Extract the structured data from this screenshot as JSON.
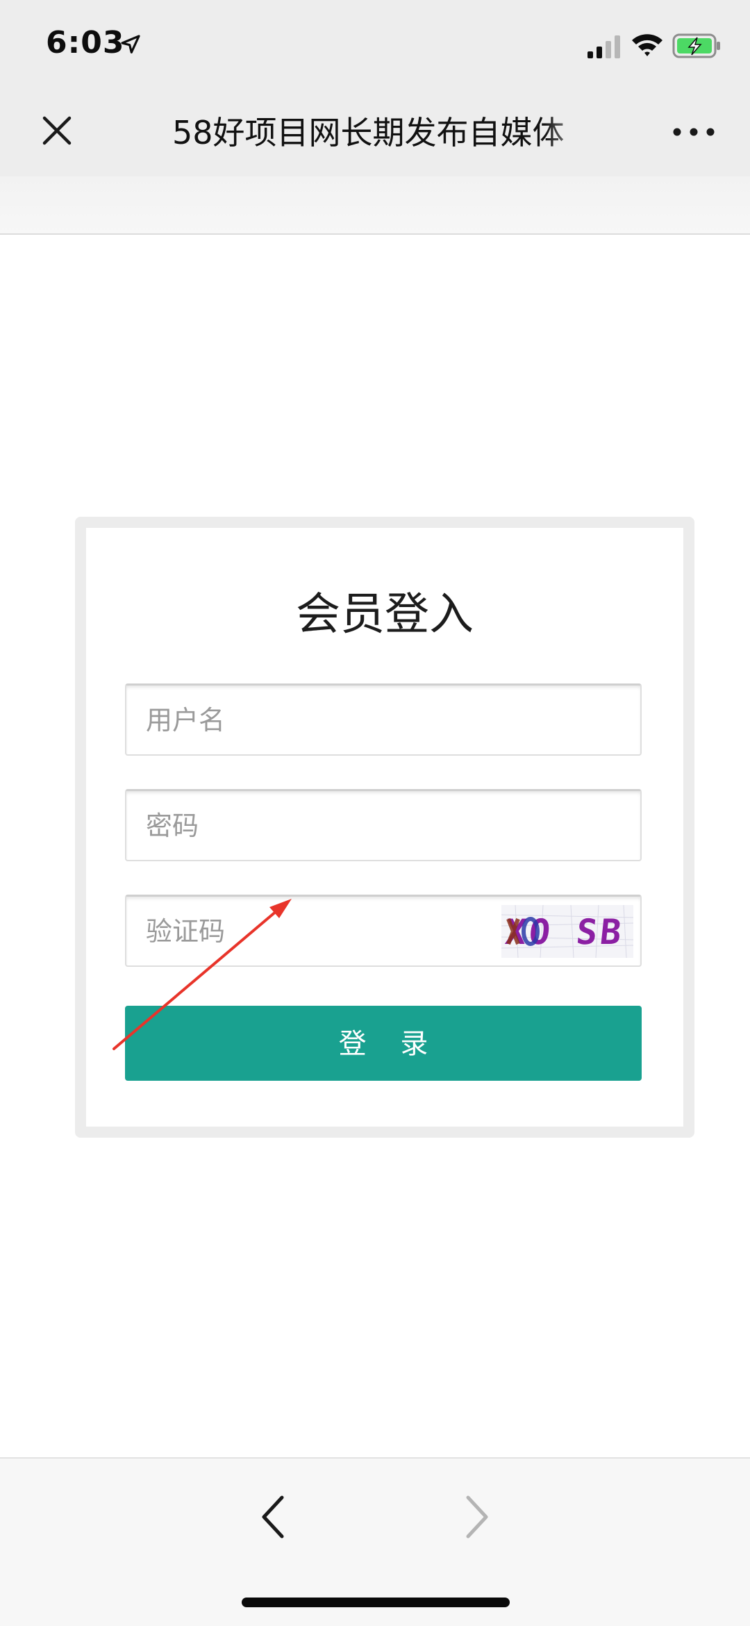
{
  "status_bar": {
    "time": "6:03",
    "icons": [
      "location-icon",
      "signal-icon",
      "wifi-icon",
      "battery-charging-icon"
    ]
  },
  "nav_bar": {
    "title": "58好项目网长期发布自媒体",
    "close_icon": "close-icon",
    "more_icon": "more-icon"
  },
  "login": {
    "title": "会员登入",
    "username_placeholder": "用户名",
    "password_placeholder": "密码",
    "captcha_placeholder": "验证码",
    "captcha_text": "XO SB",
    "button_label": "登 录",
    "button_color": "#19a190"
  },
  "annotation": {
    "arrow_color": "#e8342a"
  },
  "bottom_bar": {
    "back_icon": "chevron-left-icon",
    "forward_icon": "chevron-right-icon",
    "forward_enabled": false
  }
}
